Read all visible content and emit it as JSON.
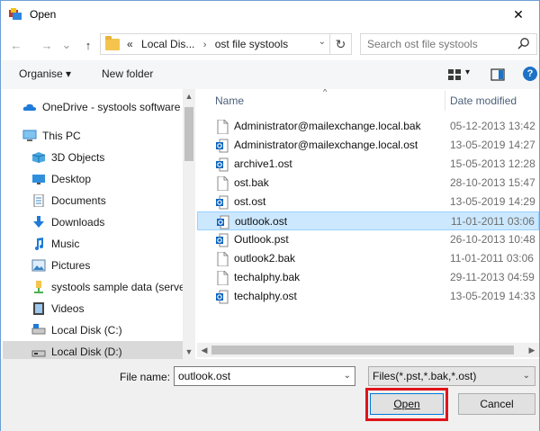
{
  "window": {
    "title": "Open",
    "close_glyph": "✕"
  },
  "nav": {
    "back_glyph": "←",
    "forward_glyph": "→",
    "history_glyph": "⌄",
    "up_glyph": "↑",
    "breadcrumb": [
      "«",
      "Local Dis...",
      "ost file systools"
    ],
    "crumb_sep": "›",
    "dropdown_glyph": "⌄",
    "refresh_glyph": "↻",
    "search_placeholder": "Search ost file systools"
  },
  "toolbar": {
    "organise": "Organise ▾",
    "new_folder": "New folder",
    "view_dd": "▾",
    "help": "?"
  },
  "sidebar": {
    "items": [
      {
        "label": "OneDrive - systools software",
        "icon": "cloud-icon"
      },
      {
        "label": "This PC",
        "icon": "computer-icon"
      },
      {
        "label": "3D Objects",
        "icon": "cube-icon"
      },
      {
        "label": "Desktop",
        "icon": "desktop-icon"
      },
      {
        "label": "Documents",
        "icon": "documents-icon"
      },
      {
        "label": "Downloads",
        "icon": "download-icon"
      },
      {
        "label": "Music",
        "icon": "music-icon"
      },
      {
        "label": "Pictures",
        "icon": "pictures-icon"
      },
      {
        "label": "systools sample data (serve",
        "icon": "network-drive-icon"
      },
      {
        "label": "Videos",
        "icon": "videos-icon"
      },
      {
        "label": "Local Disk (C:)",
        "icon": "drive-icon"
      },
      {
        "label": "Local Disk (D:)",
        "icon": "drive-icon"
      }
    ],
    "selected_index": 11
  },
  "columns": {
    "name": "Name",
    "date": "Date modified"
  },
  "files": [
    {
      "name": "Administrator@mailexchange.local.bak",
      "date": "05-12-2013 13:42",
      "icon": "file-icon"
    },
    {
      "name": "Administrator@mailexchange.local.ost",
      "date": "13-05-2019 14:27",
      "icon": "outlook-file-icon"
    },
    {
      "name": "archive1.ost",
      "date": "15-05-2013 12:28",
      "icon": "outlook-file-icon"
    },
    {
      "name": "ost.bak",
      "date": "28-10-2013 15:47",
      "icon": "file-icon"
    },
    {
      "name": "ost.ost",
      "date": "13-05-2019 14:29",
      "icon": "outlook-file-icon"
    },
    {
      "name": "outlook.ost",
      "date": "11-01-2011 03:06",
      "icon": "outlook-file-icon"
    },
    {
      "name": "Outlook.pst",
      "date": "26-10-2013 10:48",
      "icon": "outlook-file-icon"
    },
    {
      "name": "outlook2.bak",
      "date": "11-01-2011 03:06",
      "icon": "file-icon"
    },
    {
      "name": "techalphy.bak",
      "date": "29-11-2013 04:59",
      "icon": "file-icon"
    },
    {
      "name": "techalphy.ost",
      "date": "13-05-2019 14:33",
      "icon": "outlook-file-icon"
    }
  ],
  "selected_file_index": 5,
  "footer": {
    "file_name_label": "File name:",
    "file_name_value": "outlook.ost",
    "file_type": "Files(*.pst,*.bak,*.ost)",
    "open_label": "Open",
    "cancel_label": "Cancel",
    "dropdown_glyph": "⌄"
  },
  "scroll_glyphs": {
    "up": "▲",
    "down": "▼",
    "left": "◀",
    "right": "▶",
    "sort": "^"
  },
  "colors": {
    "accent": "#0078d7",
    "selection": "#cce8ff",
    "highlight_box": "#e0141b",
    "folder": "#f4c44e"
  }
}
